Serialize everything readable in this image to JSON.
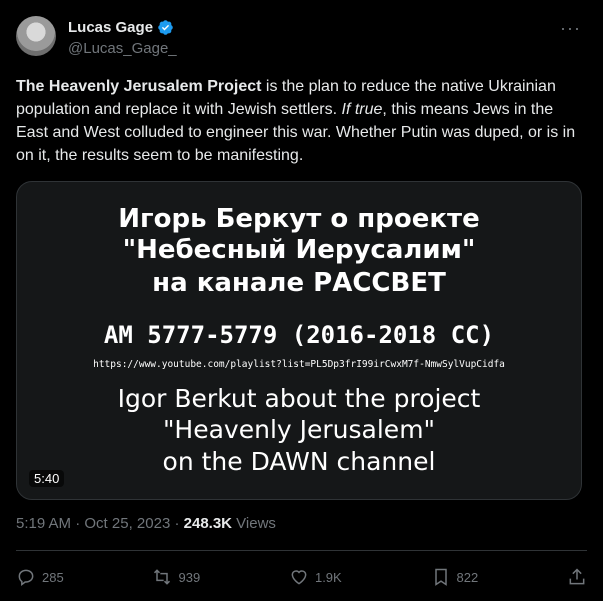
{
  "author": {
    "display_name": "Lucas Gage",
    "handle": "@Lucas_Gage_",
    "verified_icon": "verified-badge-icon"
  },
  "more_icon": "ellipsis-icon",
  "tweet": {
    "bold_lead": "The Heavenly Jerusalem Project",
    "text_part1": " is the plan to reduce the native Ukrainian population and replace it with Jewish settlers. ",
    "italic": "If true",
    "text_part2": ", this means Jews in the East and West colluded to engineer this war. Whether Putin was duped, or is in on it, the results seem to be manifesting."
  },
  "media": {
    "russian_line1": "Игорь Беркут о проекте",
    "russian_line2": "\"Небесный Иерусалим\"",
    "russian_line3": "на канале РАССВЕТ",
    "year_line": "AM 5777-5779 (2016-2018 CC)",
    "url_line": "https://www.youtube.com/playlist?list=PL5Dp3frI99irCwxM7f-NmwSylVupCidfa",
    "english_line1": "Igor Berkut about the project",
    "english_line2": "\"Heavenly Jerusalem\"",
    "english_line3": "on the DAWN channel",
    "duration": "5:40"
  },
  "meta": {
    "time": "5:19 AM",
    "sep1": " · ",
    "date": "Oct 25, 2023",
    "sep2": " · ",
    "views_count": "248.3K",
    "views_label": " Views"
  },
  "actions": {
    "replies": "285",
    "reposts": "939",
    "likes": "1.9K",
    "bookmarks": "822"
  },
  "colors": {
    "background": "#000000",
    "accent_blue": "#1d9bf0",
    "muted": "#71767b"
  }
}
